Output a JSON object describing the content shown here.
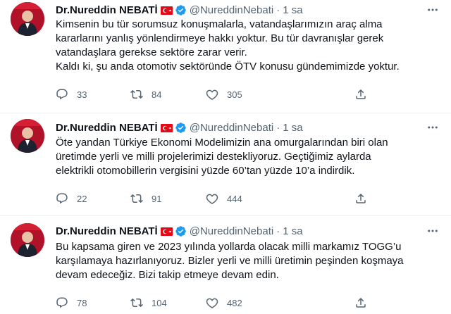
{
  "colors": {
    "text": "#0f1419",
    "muted": "#536471",
    "verified": "#1d9bf0",
    "divider": "#eff3f4",
    "flag_red": "#e30a17"
  },
  "icons": {
    "reply": "reply-icon",
    "retweet": "retweet-icon",
    "like": "heart-icon",
    "share": "share-icon",
    "more": "more-icon",
    "verified": "verified-badge-icon",
    "flag": "turkey-flag-icon"
  },
  "tweets": [
    {
      "name": "Dr.Nureddin NEBATİ",
      "handle": "@NureddinNebati",
      "separator": "·",
      "time": "1 sa",
      "lines": [
        "Kimsenin bu tür sorumsuz konuşmalarla, vatandaşlarımızın araç alma",
        "kararlarını yanlış yönlendirmeye hakkı yoktur. Bu tür davranışlar gerek",
        "vatandaşlara gerekse sektöre zarar verir.",
        "Kaldı ki, şu anda otomotiv sektöründe ÖTV konusu gündemimizde yoktur."
      ],
      "replies": "33",
      "retweets": "84",
      "likes": "305"
    },
    {
      "name": "Dr.Nureddin NEBATİ",
      "handle": "@NureddinNebati",
      "separator": "·",
      "time": "1 sa",
      "lines": [
        "Öte yandan Türkiye Ekonomi Modelimizin ana omurgalarından biri olan",
        "üretimde yerli ve milli projelerimizi destekliyoruz. Geçtiğimiz aylarda",
        "elektrikli otomobillerin vergisini yüzde 60’tan yüzde 10’a indirdik."
      ],
      "replies": "22",
      "retweets": "91",
      "likes": "444"
    },
    {
      "name": "Dr.Nureddin NEBATİ",
      "handle": "@NureddinNebati",
      "separator": "·",
      "time": "1 sa",
      "lines": [
        "Bu kapsama giren ve 2023 yılında yollarda olacak milli markamız TOGG’u",
        "karşılamaya hazırlanıyoruz. Bizler yerli ve milli üretimin peşinden koşmaya",
        "devam edeceğiz. Bizi takip etmeye devam edin."
      ],
      "replies": "78",
      "retweets": "104",
      "likes": "482"
    }
  ]
}
